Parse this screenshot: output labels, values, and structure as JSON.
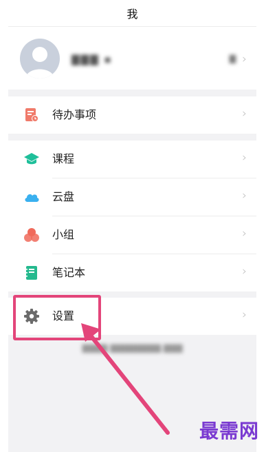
{
  "header": {
    "title": "我"
  },
  "profile": {
    "name_blurred": "▇▇▇ ▪",
    "right_blurred": "▇"
  },
  "menu": {
    "todo": {
      "label": "待办事项"
    },
    "course": {
      "label": "课程"
    },
    "cloud": {
      "label": "云盘"
    },
    "group": {
      "label": "小组"
    },
    "notebook": {
      "label": "笔记本"
    },
    "settings": {
      "label": "设置"
    }
  },
  "footer": {
    "blurred_text": "▇▇▇▇ ▇▇▇▇▇▇▇▇.▇▇▇"
  },
  "watermark": {
    "text": "最需网"
  },
  "colors": {
    "highlight": "#e3457a",
    "todo_icon": "#f07a6a",
    "course_icon": "#1fbf9a",
    "cloud_icon": "#3ab0ef",
    "group_icon": "#f06a5b",
    "notebook_icon": "#25b98e",
    "settings_icon": "#6b6b6b",
    "watermark": "#7a3ad1"
  },
  "icons": {
    "todo": "todo-icon",
    "course": "graduation-cap-icon",
    "cloud": "cloud-icon",
    "group": "group-icon",
    "notebook": "notebook-icon",
    "settings": "gear-icon",
    "chevron": "chevron-right-icon"
  }
}
